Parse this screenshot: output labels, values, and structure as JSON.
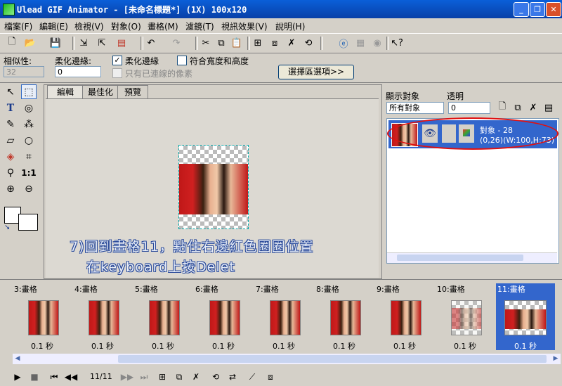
{
  "window": {
    "title": "Ulead GIF Animator - [未命名標題*] (1X) 100x120",
    "minimize_glyph": "_",
    "restore_glyph": "❐",
    "close_glyph": "✕"
  },
  "menu": [
    "檔案(F)",
    "編輯(E)",
    "檢視(V)",
    "對象(O)",
    "畫格(M)",
    "濾鏡(T)",
    "視訊效果(V)",
    "說明(H)"
  ],
  "toolbar_icons": [
    "new-file-icon",
    "open-icon",
    "save-icon",
    "import-icon",
    "export-icon",
    "color-icon",
    "undo-icon",
    "redo-icon",
    "cut-icon",
    "copy-icon",
    "paste-icon",
    "add-frame-icon",
    "duplicate-icon",
    "delete-icon",
    "tween-icon",
    "browser-icon",
    "optimize-icon",
    "preview-icon",
    "help-icon"
  ],
  "options": {
    "similarity_label": "相似性:",
    "similarity_value": "32",
    "feather_label": "柔化邊緣:",
    "feather_value": "0",
    "antialias_label": "柔化邊緣",
    "antialias_checked": "✓",
    "fit_label": "符合寬度和高度",
    "contiguous_label": "只有已連線的像素",
    "selection_button": "選擇區選項>>"
  },
  "tools": [
    "pointer-tool-icon",
    "marquee-tool-icon",
    "text-tool-icon",
    "lasso-tool-icon",
    "brush-tool-icon",
    "magic-wand-icon",
    "eraser-tool-icon",
    "ellipse-tool-icon",
    "fill-tool-icon",
    "transform-tool-icon",
    "eyedropper-tool-icon",
    "actual-size-icon",
    "zoom-in-icon",
    "zoom-out-icon"
  ],
  "tool_actual_size": "1:1",
  "workspace": {
    "tabs": [
      "編輯",
      "最佳化",
      "預覽"
    ],
    "note_line1": "7)回到畫格11，點住右邊紅色圈圈位置",
    "note_line2": "在keyboard上按Delet"
  },
  "object_panel": {
    "show_label": "顯示對象",
    "opacity_label": "透明",
    "show_value": "所有對象",
    "opacity_value": "0",
    "object_name": "對象 - 28",
    "object_info": "(0,26)(W:100,H:73)",
    "highlight_color": "#e01010"
  },
  "frames": [
    {
      "label": "3:畫格",
      "time": "0.1 秒"
    },
    {
      "label": "4:畫格",
      "time": "0.1 秒"
    },
    {
      "label": "5:畫格",
      "time": "0.1 秒"
    },
    {
      "label": "6:畫格",
      "time": "0.1 秒"
    },
    {
      "label": "7:畫格",
      "time": "0.1 秒"
    },
    {
      "label": "8:畫格",
      "time": "0.1 秒"
    },
    {
      "label": "9:畫格",
      "time": "0.1 秒"
    },
    {
      "label": "10:畫格",
      "time": "0.1 秒"
    },
    {
      "label": "11:畫格",
      "time": "0.1 秒"
    }
  ],
  "frame_counter": "11/11",
  "colors": {
    "accent": "#3366cc",
    "titlebar": "#0a5fd8"
  }
}
